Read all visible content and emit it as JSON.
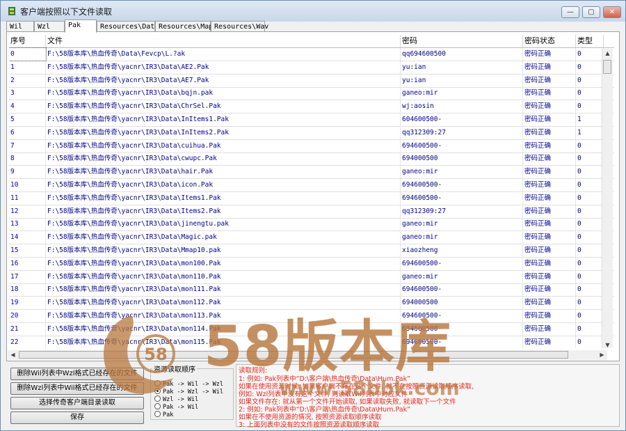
{
  "window": {
    "title": "客户端按照以下文件读取"
  },
  "tabs": [
    {
      "label": "Wil"
    },
    {
      "label": "Wzl"
    },
    {
      "label": "Pak"
    },
    {
      "label": "Resources\\Data"
    },
    {
      "label": "Resources\\Map"
    },
    {
      "label": "Resources\\Wav"
    }
  ],
  "table": {
    "headers": [
      "序号",
      "文件",
      "密码",
      "密码状态",
      "类型"
    ],
    "rows": [
      [
        "0",
        "F:\\58版本库\\热血传奇\\Data\\Fevcp\\L.?ak",
        "qq694600500",
        "密码正确",
        "0"
      ],
      [
        "1",
        "F:\\58版本库\\热血传奇\\yacnr\\IR3\\Data\\AE2.Pak",
        "yu:ian",
        "密码正确",
        "0"
      ],
      [
        "2",
        "F:\\58版本库\\热血传奇\\yacnr\\IR3\\Data\\AE7.Pak",
        "yu:ian",
        "密码正确",
        "0"
      ],
      [
        "3",
        "F:\\58版本库\\热血传奇\\yacnr\\IR3\\Data\\bqjn.pak",
        "ganeo:mir",
        "密码正确",
        "0"
      ],
      [
        "4",
        "F:\\58版本库\\热血传奇\\yacnr\\IR3\\Data\\ChrSel.Pak",
        "wj:aosin",
        "密码正确",
        "0"
      ],
      [
        "5",
        "F:\\58版本库\\热血传奇\\yacnr\\IR3\\Data\\InItems1.Pak",
        "604600500-",
        "密码正确",
        "1"
      ],
      [
        "6",
        "F:\\58版本库\\热血传奇\\yacnr\\IR3\\Data\\InItems2.Pak",
        "qq312309:27",
        "密码正确",
        "1"
      ],
      [
        "7",
        "F:\\58版本库\\热血传奇\\yacnr\\IR3\\Data\\cuihua.Pak",
        "694600500-",
        "密码正确",
        "0"
      ],
      [
        "8",
        "F:\\58版本库\\热血传奇\\yacnr\\IR3\\Data\\cwupc.Pak",
        "694000500",
        "密码正确",
        "0"
      ],
      [
        "9",
        "F:\\58版本库\\热血传奇\\yacnr\\IR3\\Data\\hair.Pak",
        "ganeo:mir",
        "密码正确",
        "0"
      ],
      [
        "10",
        "F:\\58版本库\\热血传奇\\yacnr\\IR3\\Data\\icon.Pak",
        "694600500-",
        "密码正确",
        "0"
      ],
      [
        "11",
        "F:\\58版本库\\热血传奇\\yacnr\\IR3\\Data\\Items1.Pak",
        "694600500-",
        "密码正确",
        "0"
      ],
      [
        "12",
        "F:\\58版本库\\热血传奇\\yacnr\\IR3\\Data\\Items2.Pak",
        "qq312309:27",
        "密码正确",
        "0"
      ],
      [
        "13",
        "F:\\58版本库\\热血传奇\\yacnr\\IR3\\Data\\jinengtu.pak",
        "ganeo:mir",
        "密码正确",
        "0"
      ],
      [
        "14",
        "F:\\58版本库\\热血传奇\\yacnr\\IR3\\Data\\Magic.pak",
        "ganeo:mir",
        "密码正确",
        "0"
      ],
      [
        "15",
        "F:\\58版本库\\热血传奇\\yacnr\\IR3\\Data\\Mmap10.pak",
        "xiaozheng",
        "密码正确",
        "0"
      ],
      [
        "16",
        "F:\\58版本库\\热血传奇\\yacnr\\IR3\\Data\\mon100.Pak",
        "694600500-",
        "密码正确",
        "0"
      ],
      [
        "17",
        "F:\\58版本库\\热血传奇\\yacnr\\IR3\\Data\\mon110.Pak",
        "ganeo:mir",
        "密码正确",
        "0"
      ],
      [
        "18",
        "F:\\58版本库\\热血传奇\\yacnr\\IR3\\Data\\mon111.Pak",
        "694600500-",
        "密码正确",
        "0"
      ],
      [
        "19",
        "F:\\58版本库\\热血传奇\\yacnr\\IR3\\Data\\mon112.Pak",
        "694000500",
        "密码正确",
        "0"
      ],
      [
        "20",
        "F:\\58版本库\\热血传奇\\yacnr\\IR3\\Data\\mon113.Pak",
        "694600500-",
        "密码正确",
        "0"
      ],
      [
        "21",
        "F:\\58版本库\\热血传奇\\yacnr\\IR3\\Data\\mon114.Pak",
        "694600500-",
        "密码正确",
        "0"
      ],
      [
        "22",
        "F:\\58版本库\\热血传奇\\yacnr\\IR3\\Data\\mon115.Pak",
        "694600500-",
        "密码正确",
        "0"
      ]
    ]
  },
  "buttons": {
    "delete_wil": "删除Wil列表中Wzl格式已经存在的文件",
    "delete_wzl": "删除Wzl列表中Wil格式已经存在的文件",
    "select_client": "选择传奇客户端目录读取",
    "save": "保存"
  },
  "read_order": {
    "title": "资源读取顺序",
    "options": [
      {
        "label": "Pak -> Wil -> Wzl",
        "selected": false
      },
      {
        "label": "Pak -> Wzl -> Wil",
        "selected": true
      },
      {
        "label": "Wzl -> Wil",
        "selected": false
      },
      {
        "label": "Pak -> Wil",
        "selected": false
      },
      {
        "label": "Pak",
        "selected": false
      }
    ]
  },
  "notes": {
    "title": "读取规则:",
    "lines": [
      "1: 例如: Pak列表中“D:\\客户端\\热血传奇\\Data\\Hum.Pak”",
      "   如果在使用资源时候, 如果客户端不存在这个文件, 就不在按照资源读取顺序读取,",
      "   例如: Wzl列表中没有这个文件, 则读取Wil列表中对应文件",
      "   如果文件存在: 就从第一个文件开始读取, 如果读取失败, 就读取下一个文件",
      "2: 例如: Pak列表中“D:\\客户端\\热血传奇\\Data\\Hum.Pak”",
      "   如果在不使用资源的情况, 按照资源读取顺序读取",
      "3: 上面列表中没有的文件按照资源读取顺序读取"
    ]
  },
  "watermark": {
    "text": "58版本库",
    "url_text": "www.58bbk.com",
    "logo_text": "58"
  },
  "colors": {
    "link_text": "#00008b",
    "note_text": "#e8281e",
    "watermark": "#b8783e"
  }
}
